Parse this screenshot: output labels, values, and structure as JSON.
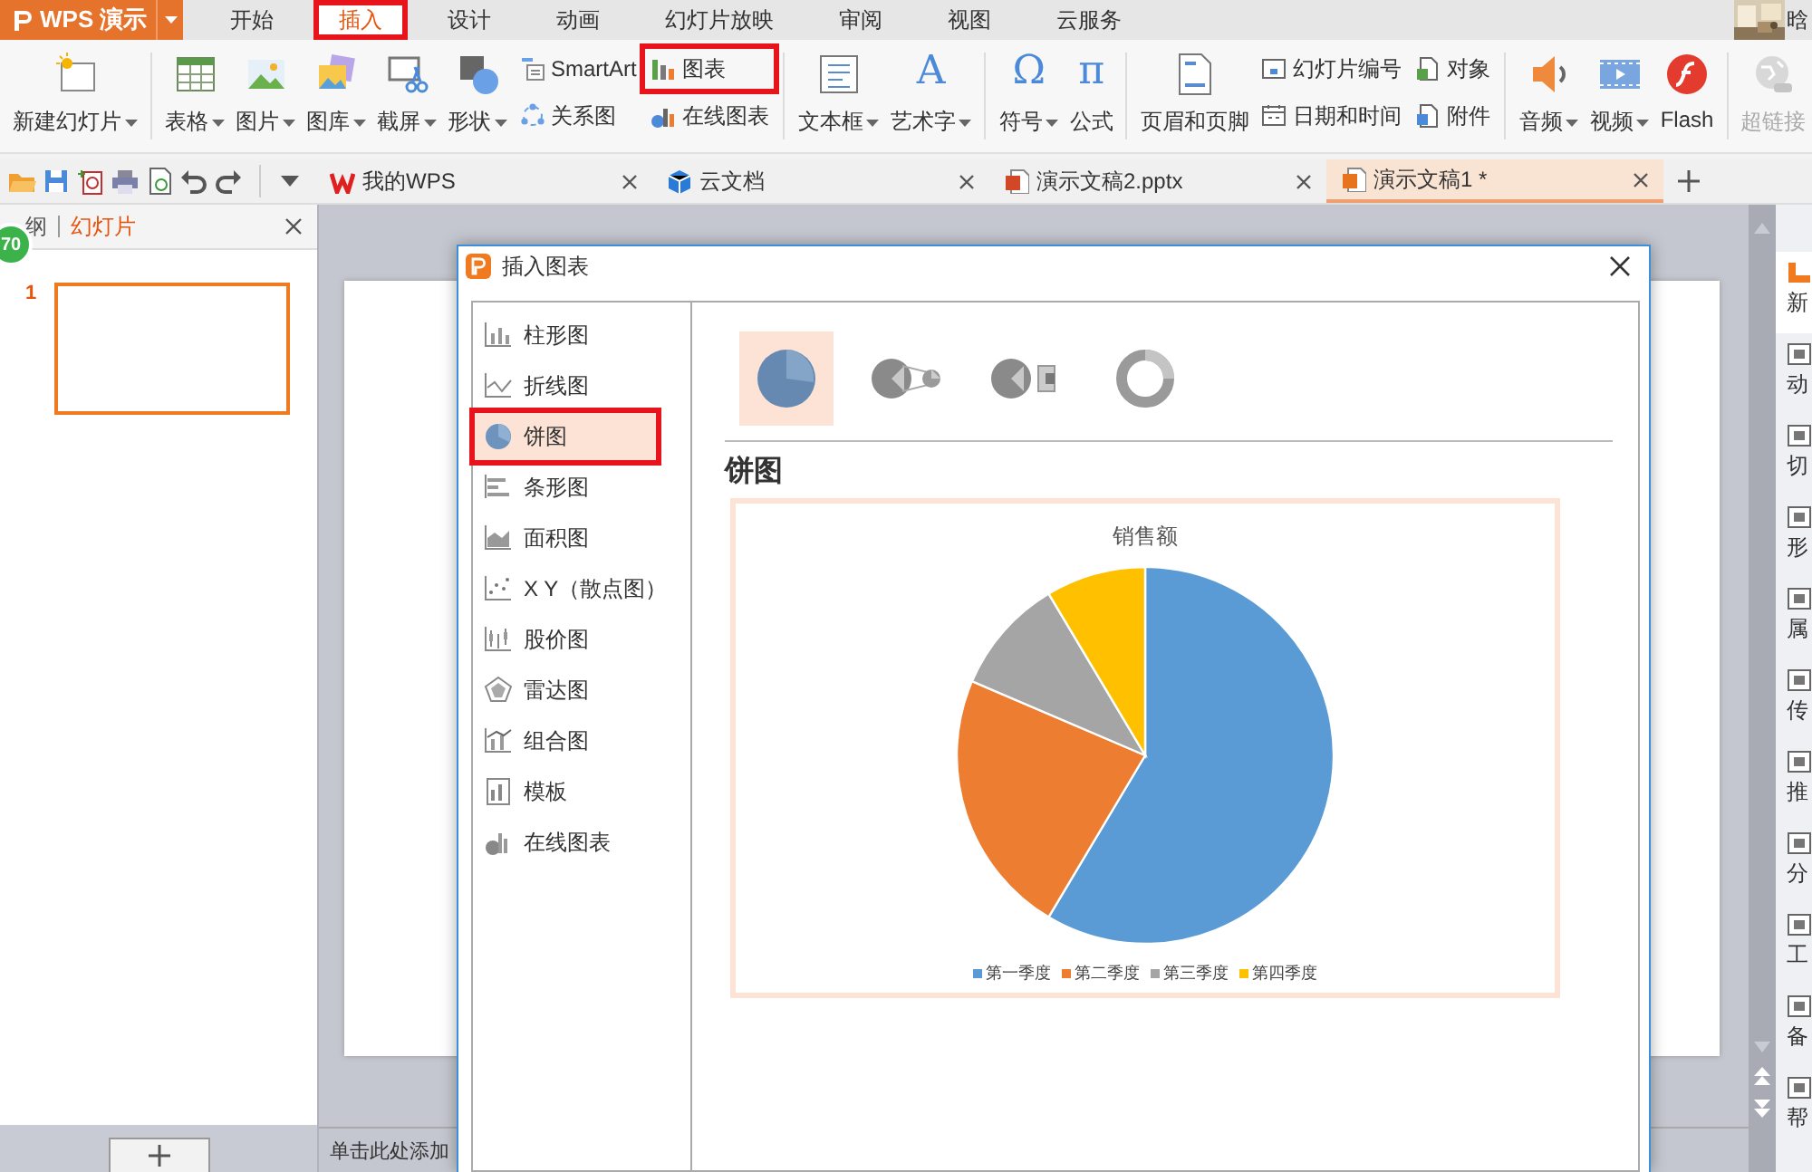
{
  "app": {
    "logo": "WPS 演示",
    "user_name": "晗",
    "menu_tabs": [
      {
        "label": "开始",
        "selected": false,
        "boxed": false
      },
      {
        "label": "插入",
        "selected": true,
        "boxed": true
      },
      {
        "label": "设计",
        "selected": false,
        "boxed": false
      },
      {
        "label": "动画",
        "selected": false,
        "boxed": false
      },
      {
        "label": "幻灯片放映",
        "selected": false,
        "boxed": false
      },
      {
        "label": "审阅",
        "selected": false,
        "boxed": false
      },
      {
        "label": "视图",
        "selected": false,
        "boxed": false
      },
      {
        "label": "云服务",
        "selected": false,
        "boxed": false
      }
    ]
  },
  "ribbon": {
    "groups": [
      {
        "items": [
          {
            "kind": "large",
            "label": "新建幻灯片",
            "dropdown": true,
            "boxed": false,
            "disabled": false
          }
        ]
      },
      {
        "items": [
          {
            "kind": "large",
            "label": "表格",
            "dropdown": true,
            "boxed": false,
            "disabled": false
          },
          {
            "kind": "large",
            "label": "图片",
            "dropdown": true,
            "boxed": false,
            "disabled": false
          },
          {
            "kind": "large",
            "label": "图库",
            "dropdown": true,
            "boxed": false,
            "disabled": false
          },
          {
            "kind": "large",
            "label": "截屏",
            "dropdown": true,
            "boxed": false,
            "disabled": false
          },
          {
            "kind": "large",
            "label": "形状",
            "dropdown": true,
            "boxed": false,
            "disabled": false
          },
          {
            "kind": "small",
            "label": "SmartArt",
            "dropdown": false,
            "boxed": false,
            "disabled": false
          },
          {
            "kind": "small",
            "label": "关系图",
            "dropdown": false,
            "boxed": false,
            "disabled": false
          },
          {
            "kind": "small",
            "label": "图表",
            "dropdown": false,
            "boxed": true,
            "disabled": false
          },
          {
            "kind": "small",
            "label": "在线图表",
            "dropdown": false,
            "boxed": false,
            "disabled": false
          }
        ]
      },
      {
        "items": [
          {
            "kind": "large",
            "label": "文本框",
            "dropdown": true,
            "boxed": false,
            "disabled": false
          },
          {
            "kind": "glyph",
            "glyph": "A",
            "label": "艺术字",
            "dropdown": true,
            "boxed": false,
            "disabled": false
          }
        ]
      },
      {
        "items": [
          {
            "kind": "glyph",
            "glyph": "Ω",
            "label": "符号",
            "dropdown": true,
            "boxed": false,
            "disabled": false
          },
          {
            "kind": "glyph",
            "glyph": "π",
            "label": "公式",
            "dropdown": false,
            "boxed": false,
            "disabled": false
          }
        ]
      },
      {
        "items": [
          {
            "kind": "large",
            "label": "页眉和页脚",
            "dropdown": false,
            "boxed": false,
            "disabled": false
          },
          {
            "kind": "small",
            "label": "幻灯片编号",
            "dropdown": false,
            "boxed": false,
            "disabled": false
          },
          {
            "kind": "small",
            "label": "日期和时间",
            "dropdown": false,
            "boxed": false,
            "disabled": false
          },
          {
            "kind": "small",
            "label": "对象",
            "dropdown": false,
            "boxed": false,
            "disabled": false
          },
          {
            "kind": "small",
            "label": "附件",
            "dropdown": false,
            "boxed": false,
            "disabled": false
          }
        ]
      },
      {
        "items": [
          {
            "kind": "large",
            "label": "音频",
            "dropdown": true,
            "boxed": false,
            "disabled": false
          },
          {
            "kind": "large",
            "label": "视频",
            "dropdown": true,
            "boxed": false,
            "disabled": false
          },
          {
            "kind": "large",
            "label": "Flash",
            "dropdown": false,
            "boxed": false,
            "disabled": false
          }
        ]
      },
      {
        "items": [
          {
            "kind": "large",
            "label": "超链接",
            "dropdown": false,
            "boxed": false,
            "disabled": true
          }
        ]
      }
    ]
  },
  "doc_tabs": [
    {
      "label": "我的WPS",
      "selected": false
    },
    {
      "label": "云文档",
      "selected": false
    },
    {
      "label": "演示文稿2.pptx",
      "selected": false
    },
    {
      "label": "演示文稿1 *",
      "selected": true
    }
  ],
  "slides_panel": {
    "badge": "70",
    "tabs": [
      {
        "label": "纲",
        "selected": false
      },
      {
        "label": "幻灯片",
        "selected": true
      }
    ],
    "slides": [
      {
        "number": "1",
        "selected": true
      }
    ]
  },
  "notes_hint": "单击此处添加",
  "side_panel": {
    "items": [
      {
        "label": "新",
        "selected": true
      },
      {
        "label": "动",
        "selected": false
      },
      {
        "label": "切",
        "selected": false
      },
      {
        "label": "形",
        "selected": false
      },
      {
        "label": "属",
        "selected": false
      },
      {
        "label": "传",
        "selected": false
      },
      {
        "label": "推",
        "selected": false
      },
      {
        "label": "分",
        "selected": false
      },
      {
        "label": "工",
        "selected": false
      },
      {
        "label": "备",
        "selected": false
      },
      {
        "label": "帮",
        "selected": false
      }
    ]
  },
  "dialog": {
    "title": "插入图表",
    "chart_types": [
      {
        "label": "柱形图",
        "selected": false,
        "boxed": false
      },
      {
        "label": "折线图",
        "selected": false,
        "boxed": false
      },
      {
        "label": "饼图",
        "selected": true,
        "boxed": true
      },
      {
        "label": "条形图",
        "selected": false,
        "boxed": false
      },
      {
        "label": "面积图",
        "selected": false,
        "boxed": false
      },
      {
        "label": "X Y（散点图）",
        "selected": false,
        "boxed": false
      },
      {
        "label": "股价图",
        "selected": false,
        "boxed": false
      },
      {
        "label": "雷达图",
        "selected": false,
        "boxed": false
      },
      {
        "label": "组合图",
        "selected": false,
        "boxed": false
      },
      {
        "label": "模板",
        "selected": false,
        "boxed": false
      },
      {
        "label": "在线图表",
        "selected": false,
        "boxed": false
      }
    ],
    "variants": [
      {
        "selected": true
      },
      {
        "selected": false
      },
      {
        "selected": false
      },
      {
        "selected": false
      }
    ],
    "heading": "饼图",
    "preview": {
      "title": "销售额",
      "legend": [
        {
          "label": "第一季度",
          "color": "#5b9bd5"
        },
        {
          "label": "第二季度",
          "color": "#ed7d31"
        },
        {
          "label": "第三季度",
          "color": "#a5a5a5"
        },
        {
          "label": "第四季度",
          "color": "#ffc000"
        }
      ]
    }
  }
}
